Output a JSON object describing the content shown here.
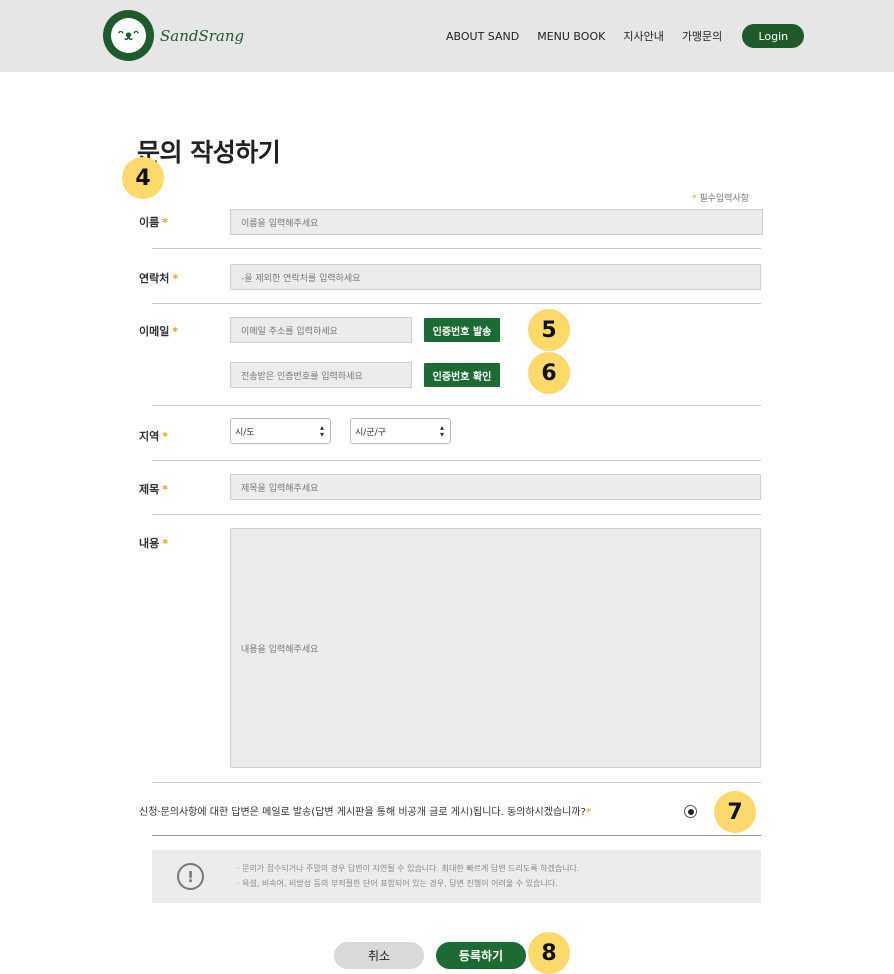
{
  "header": {
    "brand": "SandSrang",
    "nav": [
      "ABOUT SAND",
      "MENU BOOK",
      "지사안내",
      "가맹문의"
    ],
    "login_label": "Login"
  },
  "page": {
    "title": "문의 작성하기",
    "required_note": "필수입력사항",
    "star": "*"
  },
  "form": {
    "name_label": "이름",
    "name_placeholder": "이름을 입력해주세요",
    "contact_label": "연락처",
    "contact_placeholder": "-을 제외한 연락처를 입력하세요",
    "email_label": "이메일",
    "email_placeholder": "이메일 주소를 입력하세요",
    "send_code_label": "인증번호 발송",
    "code_placeholder": "전송받은 인증번호를 입력하세요",
    "verify_code_label": "인증번호 확인",
    "region_label": "지역",
    "city_value": "시/도",
    "district_value": "시/군/구",
    "subject_label": "제목",
    "subject_placeholder": "제목을 입력해주세요",
    "content_label": "내용",
    "content_placeholder": "내용을 입력해주세요"
  },
  "agree": {
    "text": "신청·문의사항에 대한 답변은 메일로 발송(답변 게시판을 통해 비공개 글로 게시)됩니다. 동의하시겠습니까?"
  },
  "notice": {
    "line1": "· 문의가 접수되거나 주말의 경우 답변이 지연될 수 있습니다. 최대한 빠르게 답변 드리도록 하겠습니다.",
    "line2": "· 욕설, 비속어, 비방성 등의 부적절한 단어 표함되어 있는 경우, 답변 진행이 어려울 수 있습니다."
  },
  "buttons": {
    "cancel": "취소",
    "submit": "등록하기"
  },
  "badges": {
    "b4": "4",
    "b5": "5",
    "b6": "6",
    "b7": "7",
    "b8": "8"
  },
  "colors": {
    "brand_green": "#1e6a34",
    "star": "#e0a018",
    "badge": "#fbd96a"
  }
}
